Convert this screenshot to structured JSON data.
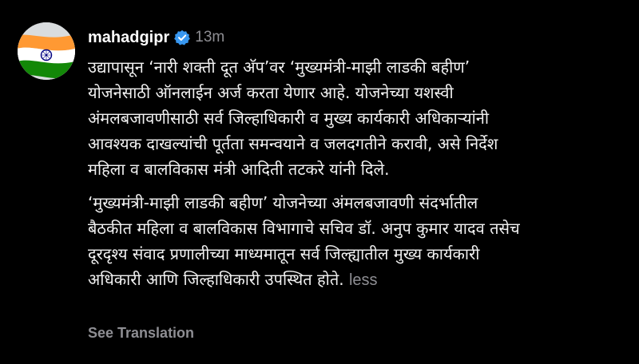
{
  "post": {
    "avatar_icon": "india-flag-icon",
    "username": "mahadgipr",
    "verified_icon": "verified-badge-icon",
    "verified_color": "#3897f0",
    "timestamp": "13m",
    "caption": {
      "paragraph_1": [
        "उद्यापासून ‘नारी शक्ती दूत अ‍ॅप’वर ‘मुख्यमंत्री-माझी लाडकी बहीण’",
        "योजनेसाठी ऑनलाईन अर्ज करता येणार आहे. योजनेच्या यशस्वी",
        "अंमलबजावणीसाठी सर्व जिल्हाधिकारी व मुख्य कार्यकारी अधिकाऱ्यांनी",
        "आवश्यक दाखल्यांची पूर्तता समन्वयाने व जलदगतीने करावी, असे निर्देश",
        "महिला व बालविकास मंत्री आदिती तटकरे यांनी दिले."
      ],
      "paragraph_2": [
        "‘मुख्यमंत्री-माझी लाडकी बहीण’ योजनेच्या अंमलबजावणी संदर्भातील",
        "बैठकीत महिला व बालविकास विभागाचे सचिव डॉ. अनुप कुमार यादव तसेच",
        "दूरदृश्य संवाद प्रणालीच्या माध्यमातून सर्व जिल्ह्यातील मुख्य कार्यकारी",
        "अधिकारी आणि जिल्हाधिकारी उपस्थित होते."
      ],
      "less_label": "less"
    },
    "see_translation_label": "See Translation"
  }
}
